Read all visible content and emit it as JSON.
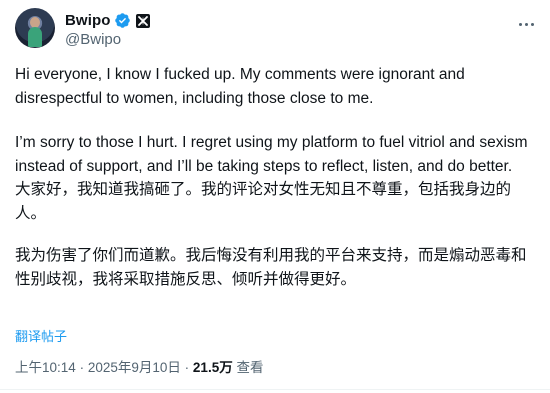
{
  "author": {
    "display_name": "Bwipo",
    "handle": "@Bwipo"
  },
  "tweet": {
    "en_paragraph_1": "Hi everyone, I know I fucked up. My comments were ignorant and disrespectful to women, including those close to me.",
    "en_paragraph_2": "I’m sorry to those I hurt. I regret using my platform to fuel vitriol and sexism instead of support, and I’ll be taking steps to reflect, listen, and do better.",
    "zh_paragraph_1": "大家好，我知道我搞砸了。我的评论对女性无知且不尊重，包括我身边的人。",
    "zh_paragraph_2": "我为伤害了你们而道歉。我后悔没有利用我的平台来支持，而是煽动恶毒和性别歧视，我将采取措施反思、倾听并做得更好。"
  },
  "translate_label": "翻译帖子",
  "meta": {
    "time": "上午10:14",
    "separator": "·",
    "date": "2025年9月10日",
    "views_count": "21.5万",
    "views_label": "查看"
  },
  "colors": {
    "text": "#0f1419",
    "secondary": "#536471",
    "accent": "#1d9bf0"
  },
  "icons": {
    "verified": "verified-badge-icon",
    "affiliate": "affiliate-badge-icon",
    "more": "more-options-icon"
  }
}
